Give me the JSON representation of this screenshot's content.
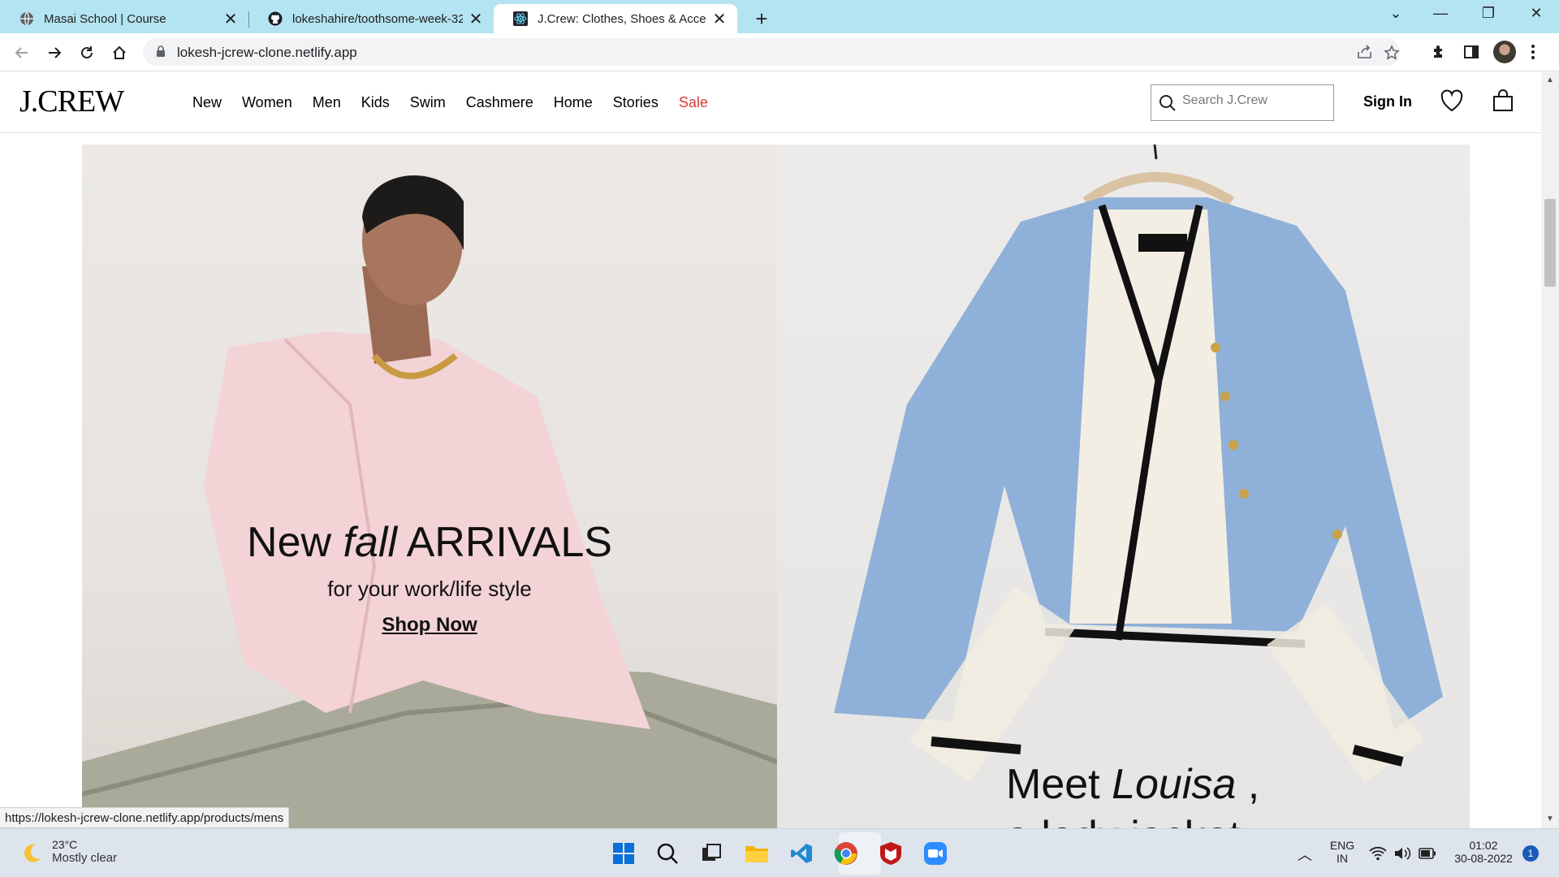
{
  "browser": {
    "tabs": [
      {
        "title": "Masai School | Course",
        "icon": "globe-icon",
        "active": false
      },
      {
        "title": "lokeshahire/toothsome-week-32...",
        "icon": "github-icon",
        "active": false
      },
      {
        "title": "J.Crew: Clothes, Shoes & Accesso...",
        "icon": "react-icon",
        "active": true
      }
    ],
    "url": "lokesh-jcrew-clone.netlify.app",
    "status_url": "https://lokesh-jcrew-clone.netlify.app/products/mens"
  },
  "site": {
    "logo": "J.CREW",
    "nav": [
      "New",
      "Women",
      "Men",
      "Kids",
      "Swim",
      "Cashmere",
      "Home",
      "Stories",
      "Sale"
    ],
    "search_placeholder": "Search J.Crew",
    "sign_in": "Sign In",
    "colors": {
      "sale": "#d43b35",
      "text": "#000000"
    }
  },
  "hero_left": {
    "title_prefix": "New ",
    "title_italic": "fall",
    "title_suffix": " ARRIVALS",
    "subtitle": "for your work/life style",
    "cta": "Shop Now"
  },
  "hero_right": {
    "title_prefix": "Meet ",
    "title_italic": "Louisa",
    "title_suffix": " ,",
    "subtitle_partial": "a lady jacket"
  },
  "taskbar": {
    "weather_temp": "23°C",
    "weather_condition": "Mostly clear",
    "lang_line1": "ENG",
    "lang_line2": "IN",
    "time": "01:02",
    "date": "30-08-2022",
    "notifications": "1"
  }
}
